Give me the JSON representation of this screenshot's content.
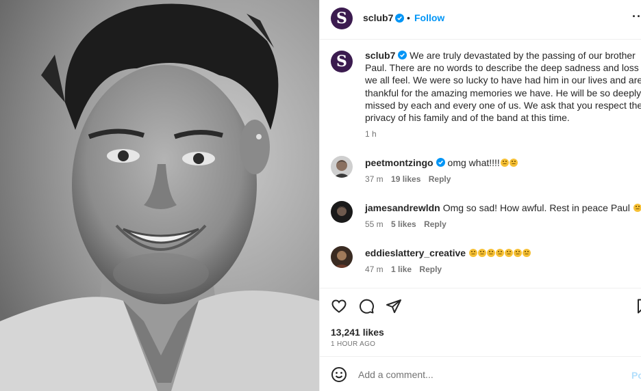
{
  "account": {
    "username": "sclub7",
    "avatar_letter": "S",
    "verified_icon": "verified-badge-icon",
    "follow_separator": "•",
    "follow_label": "Follow",
    "more_label": "···"
  },
  "caption": {
    "username": "sclub7",
    "text": "We are truly devastated by the passing of our brother Paul. There are no words to describe the deep sadness and loss we all feel. We were so lucky to have had him in our lives and are thankful for the amazing memories we have. He will be so deeply missed by each and every one of us. We ask that you respect the privacy of his family and of the band at this time.",
    "time": "1 h"
  },
  "comments": [
    {
      "username": "peetmontzingo",
      "verified": true,
      "text": "omg what!!!!",
      "emoji_count": 2,
      "time": "37 m",
      "likes": "19 likes",
      "reply": "Reply"
    },
    {
      "username": "jamesandrewldn",
      "verified": false,
      "text": "Omg so sad! How awful. Rest in peace Paul",
      "emoji_count": 1,
      "time": "55 m",
      "likes": "5 likes",
      "reply": "Reply"
    },
    {
      "username": "eddieslattery_creative",
      "verified": false,
      "text": "",
      "emoji_count": 7,
      "time": "47 m",
      "likes": "1 like",
      "reply": "Reply"
    }
  ],
  "actions": {
    "icons": [
      "heart-icon",
      "comment-icon",
      "share-icon",
      "bookmark-icon"
    ],
    "likes_count": "13,241 likes",
    "post_time": "1 HOUR AGO"
  },
  "add_comment": {
    "placeholder": "Add a comment...",
    "post_label": "Po"
  },
  "colors": {
    "link_blue": "#0095f6",
    "post_disabled": "#b2dffc",
    "avatar_purple": "#3b1b4f",
    "secondary_text": "#737373"
  }
}
